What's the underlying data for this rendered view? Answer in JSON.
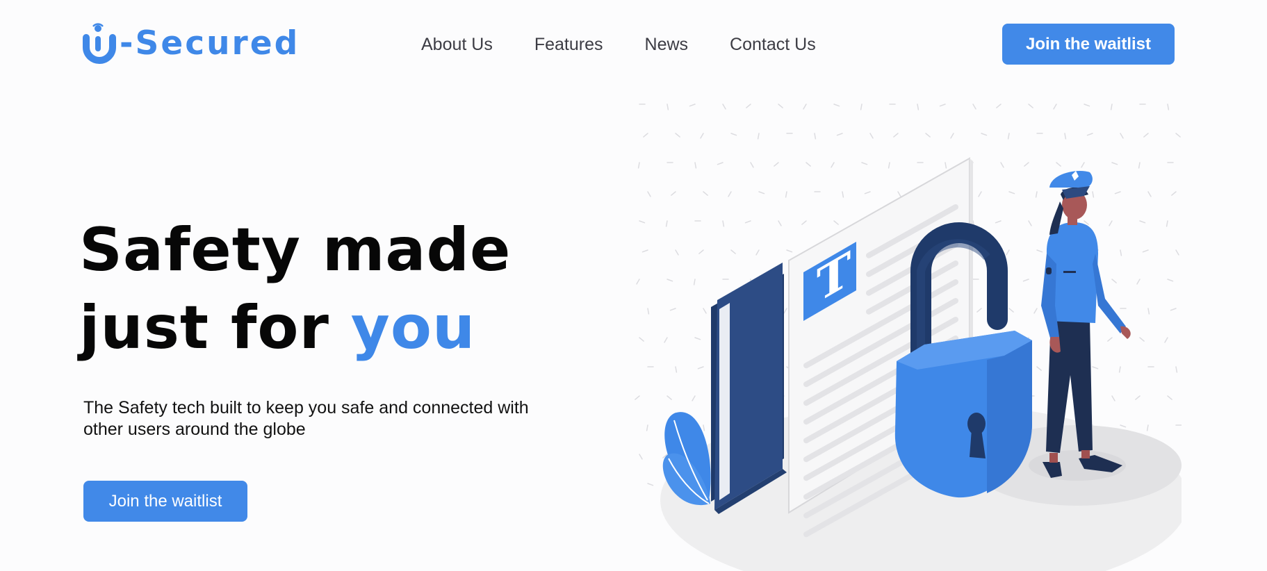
{
  "brand": {
    "name": "-Secured",
    "accent": "#3f88e8"
  },
  "nav": {
    "items": [
      {
        "label": "About Us"
      },
      {
        "label": "Features"
      },
      {
        "label": "News"
      },
      {
        "label": "Contact Us"
      }
    ],
    "cta_label": "Join the waitlist"
  },
  "hero": {
    "title_line1": "Safety made",
    "title_line2_prefix": "just for ",
    "title_line2_accent": "you",
    "subtitle": "The Safety tech built to keep you safe and connected with other users around the globe",
    "cta_label": "Join the waitlist"
  },
  "illustration": {
    "document_letter": "T",
    "icons": [
      "folder-icon",
      "document-icon",
      "padlock-icon",
      "police-officer-figure",
      "leaf-icon"
    ]
  },
  "colors": {
    "primary": "#4189e8",
    "navy": "#2c4a80",
    "dark_navy": "#1e2f52",
    "text": "#070707"
  }
}
